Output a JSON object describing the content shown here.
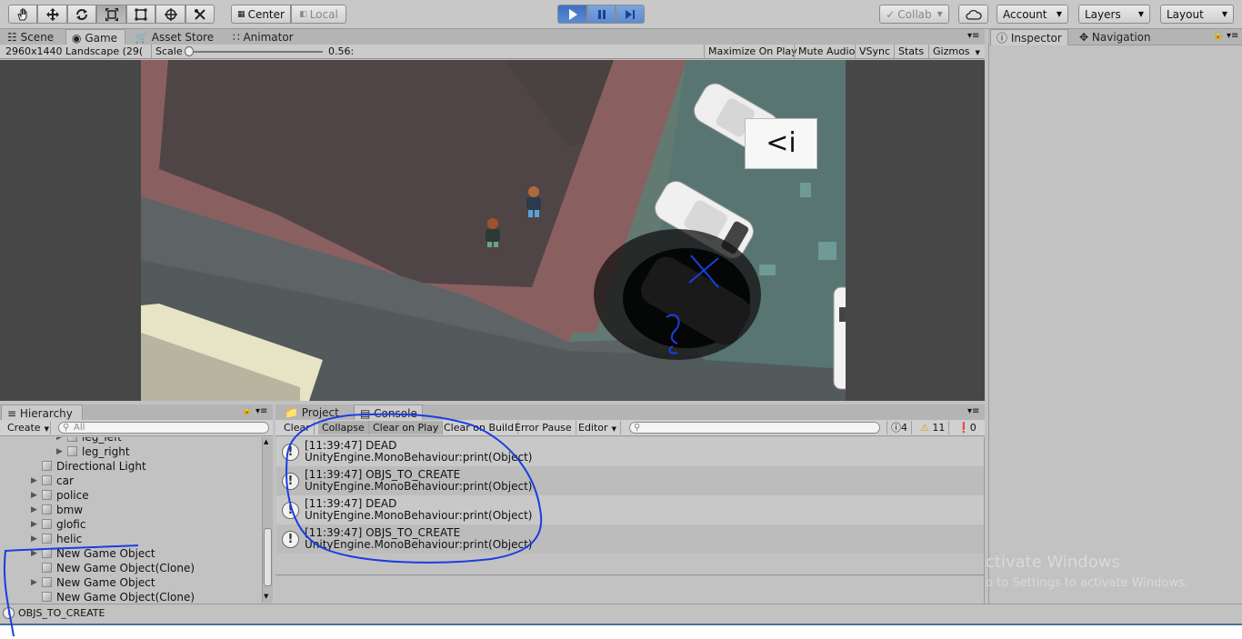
{
  "toolbar": {
    "tools": [
      "hand-tool",
      "move-tool",
      "rotate-tool",
      "scale-tool",
      "rect-tool",
      "transform-tool",
      "custom-tool"
    ],
    "pivot_mode": "Center",
    "pivot_space": "Local",
    "collab": "Collab",
    "account": "Account",
    "layers": "Layers",
    "layout": "Layout"
  },
  "tabs": {
    "scene": "Scene",
    "game": "Game",
    "asset_store": "Asset Store",
    "animator": "Animator",
    "inspector": "Inspector",
    "navigation": "Navigation"
  },
  "game_bar": {
    "resolution": "2960x1440 Landscape (29(",
    "scale_label": "Scale",
    "scale_value": "0.56:",
    "scale_fraction": 0.0,
    "maximize": "Maximize On Play",
    "mute": "Mute Audio",
    "vsync": "VSync",
    "stats": "Stats",
    "gizmos": "Gizmos"
  },
  "game_overlay": {
    "label": "<i"
  },
  "hierarchy": {
    "tab": "Hierarchy",
    "create": "Create",
    "search_placeholder": "All",
    "items": [
      {
        "label": "leg_left",
        "indent": 3,
        "arrow": true
      },
      {
        "label": "leg_right",
        "indent": 3,
        "arrow": true
      },
      {
        "label": "Directional Light",
        "indent": 1,
        "arrow": false
      },
      {
        "label": "car",
        "indent": 1,
        "arrow": true
      },
      {
        "label": "police",
        "indent": 1,
        "arrow": true
      },
      {
        "label": "bmw",
        "indent": 1,
        "arrow": true
      },
      {
        "label": "glofic",
        "indent": 1,
        "arrow": true
      },
      {
        "label": "helic",
        "indent": 1,
        "arrow": true
      },
      {
        "label": "New Game Object",
        "indent": 1,
        "arrow": true
      },
      {
        "label": "New Game Object(Clone)",
        "indent": 1,
        "arrow": false
      },
      {
        "label": "New Game Object",
        "indent": 1,
        "arrow": true
      },
      {
        "label": "New Game Object(Clone)",
        "indent": 1,
        "arrow": false
      }
    ]
  },
  "console": {
    "project_tab": "Project",
    "console_tab": "Console",
    "clear": "Clear",
    "collapse": "Collapse",
    "clear_on_play": "Clear on Play",
    "clear_on_build": "Clear on Build",
    "error_pause": "Error Pause",
    "editor": "Editor",
    "count_info": "4",
    "count_warn": "11",
    "count_error": "0",
    "logs": [
      {
        "line1": "[11:39:47] DEAD",
        "line2": "UnityEngine.MonoBehaviour:print(Object)"
      },
      {
        "line1": "[11:39:47] OBJS_TO_CREATE",
        "line2": "UnityEngine.MonoBehaviour:print(Object)"
      },
      {
        "line1": "[11:39:47] DEAD",
        "line2": "UnityEngine.MonoBehaviour:print(Object)"
      },
      {
        "line1": "[11:39:47] OBJS_TO_CREATE",
        "line2": "UnityEngine.MonoBehaviour:print(Object)"
      }
    ]
  },
  "status": {
    "message": "OBJS_TO_CREATE"
  },
  "watermark": {
    "line1": "Activate Windows",
    "line2": "Go to Settings to activate Windows."
  },
  "colors": {
    "editor_bg": "#c2c2c2",
    "annotation_ink": "#1a3ee0",
    "play_blue": "#3d6fc4"
  }
}
